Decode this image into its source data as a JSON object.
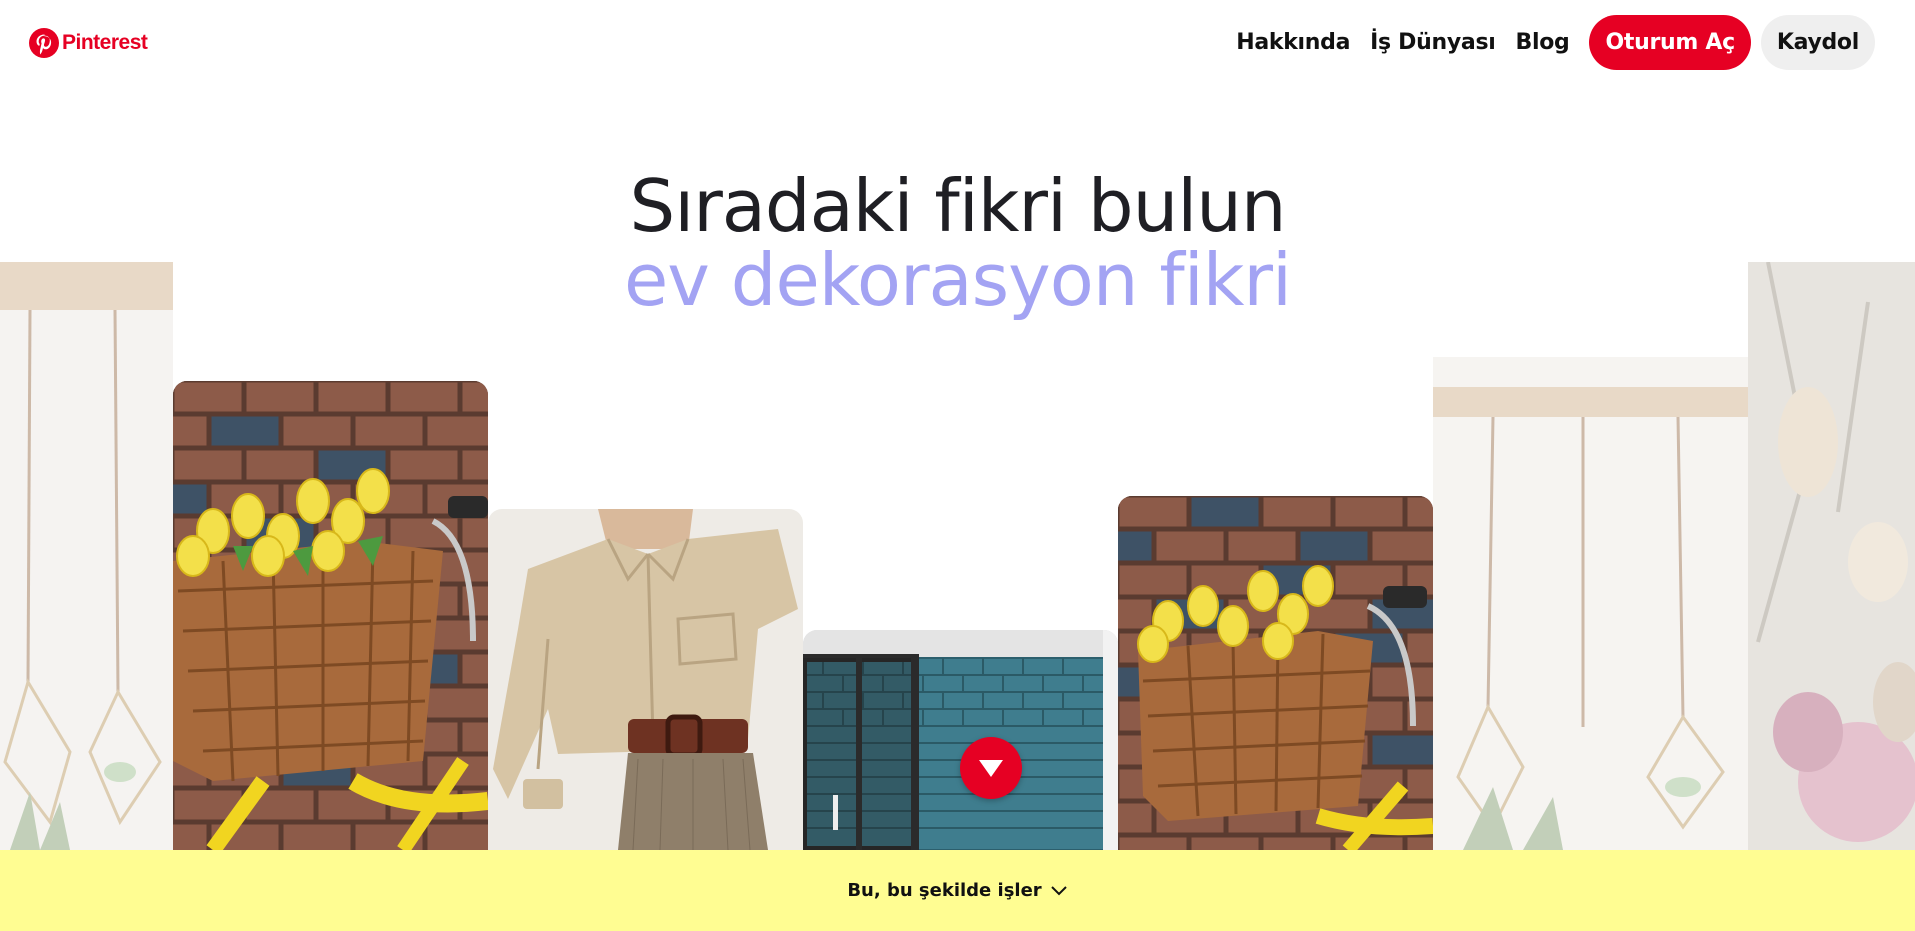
{
  "brand": {
    "name": "Pinterest",
    "color": "#e60023",
    "icon": "pinterest-logo-icon"
  },
  "nav": {
    "about": "Hakkında",
    "business": "İş Dünyası",
    "blog": "Blog",
    "login": "Oturum Aç",
    "signup": "Kaydol"
  },
  "headline": {
    "line1": "Sıradaki fikri bulun",
    "line2": "ev dekorasyon fikri",
    "accent_color": "#a3a3f3"
  },
  "tiles": [
    {
      "subject": "hanging air plant planters",
      "faded": true
    },
    {
      "subject": "yellow bicycle with basket of yellow tulips",
      "faded": false
    },
    {
      "subject": "beige oversized shirt with brown belt",
      "faded": false
    },
    {
      "subject": "blue tiled bathroom",
      "faded": false
    },
    {
      "subject": "yellow bicycle with basket of yellow tulips",
      "faded": false
    },
    {
      "subject": "hanging air plant planters",
      "faded": true
    },
    {
      "subject": "dried flower bouquet",
      "faded": true
    }
  ],
  "next_button": {
    "icon": "triangle-down-icon"
  },
  "footer": {
    "label": "Bu, bu şekilde işler",
    "icon": "chevron-down-icon",
    "color": "#fffd92"
  }
}
